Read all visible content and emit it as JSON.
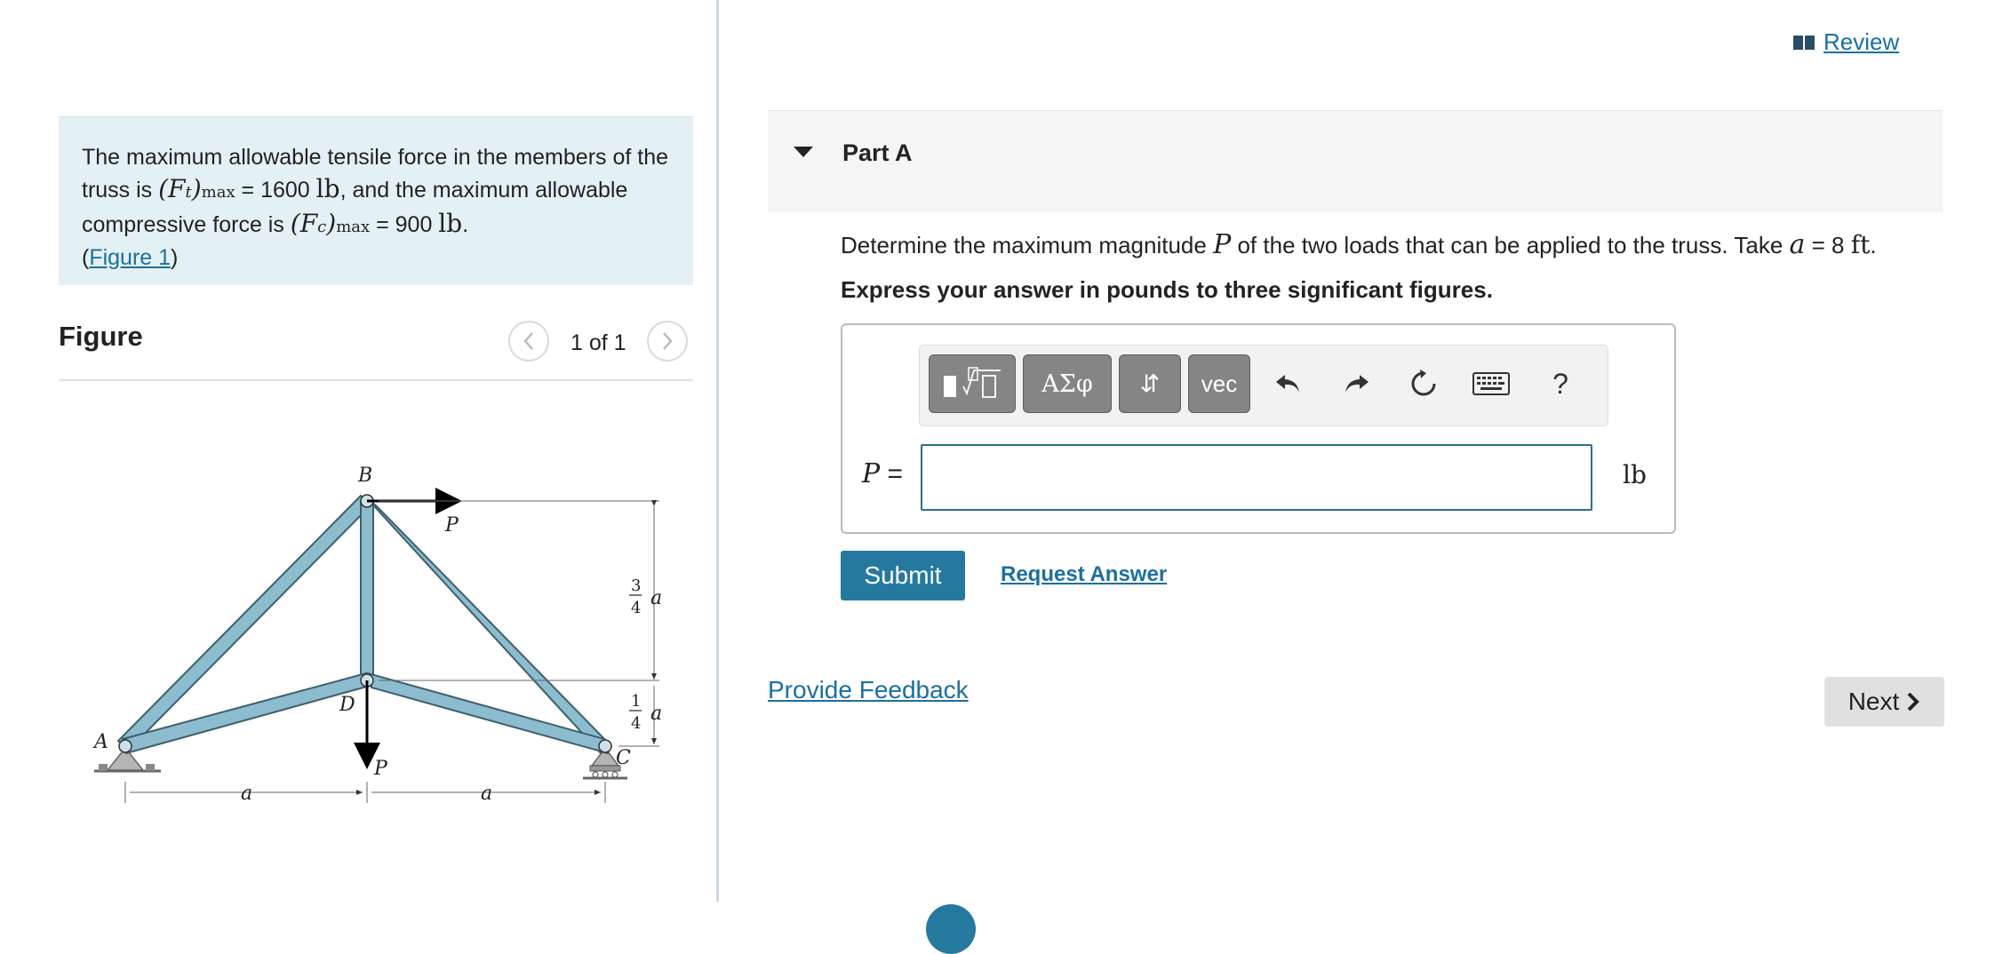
{
  "intro": {
    "text_1": "The maximum allowable tensile force in the members of the truss is ",
    "ft_symbol": "(F",
    "ft_sub": "t",
    "ft_close": ")",
    "max_sub": "max",
    "ft_value": " = 1600 ",
    "unit_lb": "lb",
    "text_2": ", and the maximum allowable compressive force is ",
    "fc_symbol": "(F",
    "fc_sub": "c",
    "fc_close": ")",
    "fc_value": " = 900 ",
    "text_3": ".",
    "figure_link_open": "(",
    "figure_link": "Figure 1",
    "figure_link_close": ")"
  },
  "figure": {
    "title": "Figure",
    "pager": "1 of 1",
    "labels": {
      "B": "B",
      "A": "A",
      "C": "C",
      "D": "D",
      "P": "P",
      "a": "a",
      "three": "3",
      "four": "4",
      "one": "1"
    }
  },
  "header": {
    "review_label": "Review"
  },
  "part": {
    "title": "Part A",
    "question_1": "Determine the maximum magnitude ",
    "question_var": "P",
    "question_2": " of the two loads that can be applied to the truss. Take ",
    "question_a": "a",
    "question_3": " = 8 ",
    "question_unit": "ft",
    "question_4": ".",
    "instruction": "Express your answer in pounds to three significant figures."
  },
  "toolbar": {
    "greek_label": "ΑΣφ",
    "arrows_label": "⇵",
    "vec_label": "vec",
    "help_label": "?"
  },
  "answer": {
    "variable": "P",
    "equals": " =",
    "value": "",
    "unit": "lb"
  },
  "actions": {
    "submit_label": "Submit",
    "request_answer_label": "Request Answer",
    "feedback_label": "Provide Feedback",
    "next_label": "Next"
  },
  "colors": {
    "accent": "#26799e",
    "link": "#1c6fa0",
    "truss_member": "#8cbcce",
    "intro_bg": "#e4f1f4"
  }
}
